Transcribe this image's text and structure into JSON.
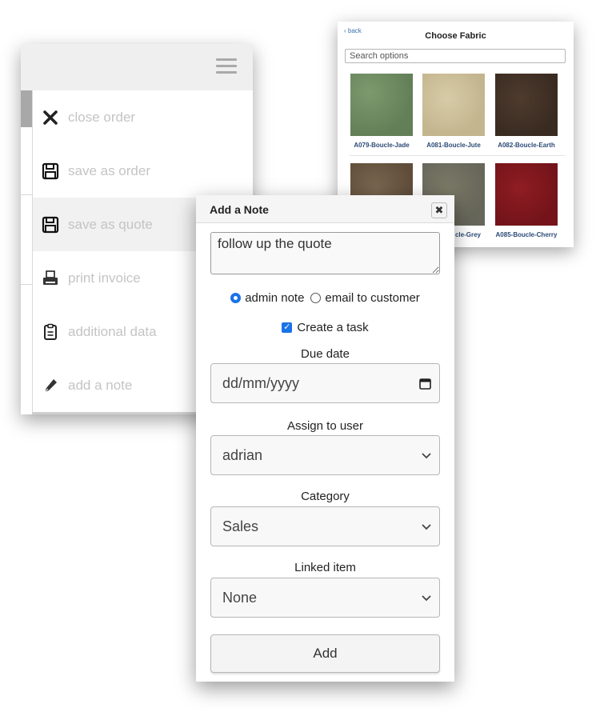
{
  "menu": {
    "items": [
      {
        "label": "close order",
        "icon": "close-icon"
      },
      {
        "label": "save as order",
        "icon": "floppy-disk-icon"
      },
      {
        "label": "save as quote",
        "icon": "floppy-disk-icon"
      },
      {
        "label": "print invoice",
        "icon": "printer-icon"
      },
      {
        "label": "additional data",
        "icon": "clipboard-icon"
      },
      {
        "label": "add a note",
        "icon": "pen-icon"
      }
    ]
  },
  "fabric": {
    "back_label": "‹ back",
    "title": "Choose Fabric",
    "search_placeholder": "Search options",
    "swatches": [
      {
        "label": "A079-Boucle-Jade"
      },
      {
        "label": "A081-Boucle-Jute"
      },
      {
        "label": "A082-Boucle-Earth"
      },
      {
        "label": ""
      },
      {
        "label": "cle-Grey"
      },
      {
        "label": "A085-Boucle-Cherry"
      }
    ]
  },
  "note": {
    "title": "Add a Note",
    "close_symbol": "✖",
    "text_value": "follow up the quote",
    "radio_admin": "admin note",
    "radio_email": "email to customer",
    "create_task": "Create a task",
    "due_date_label": "Due date",
    "due_date_placeholder": "dd/mm/yyyy",
    "assign_label": "Assign to user",
    "assign_value": "adrian",
    "category_label": "Category",
    "category_value": "Sales",
    "linked_label": "Linked item",
    "linked_value": "None",
    "add_label": "Add"
  },
  "colors": {
    "accent": "#1a73e8",
    "link": "#3a6fb0",
    "menu_text": "#c4c4c4"
  }
}
